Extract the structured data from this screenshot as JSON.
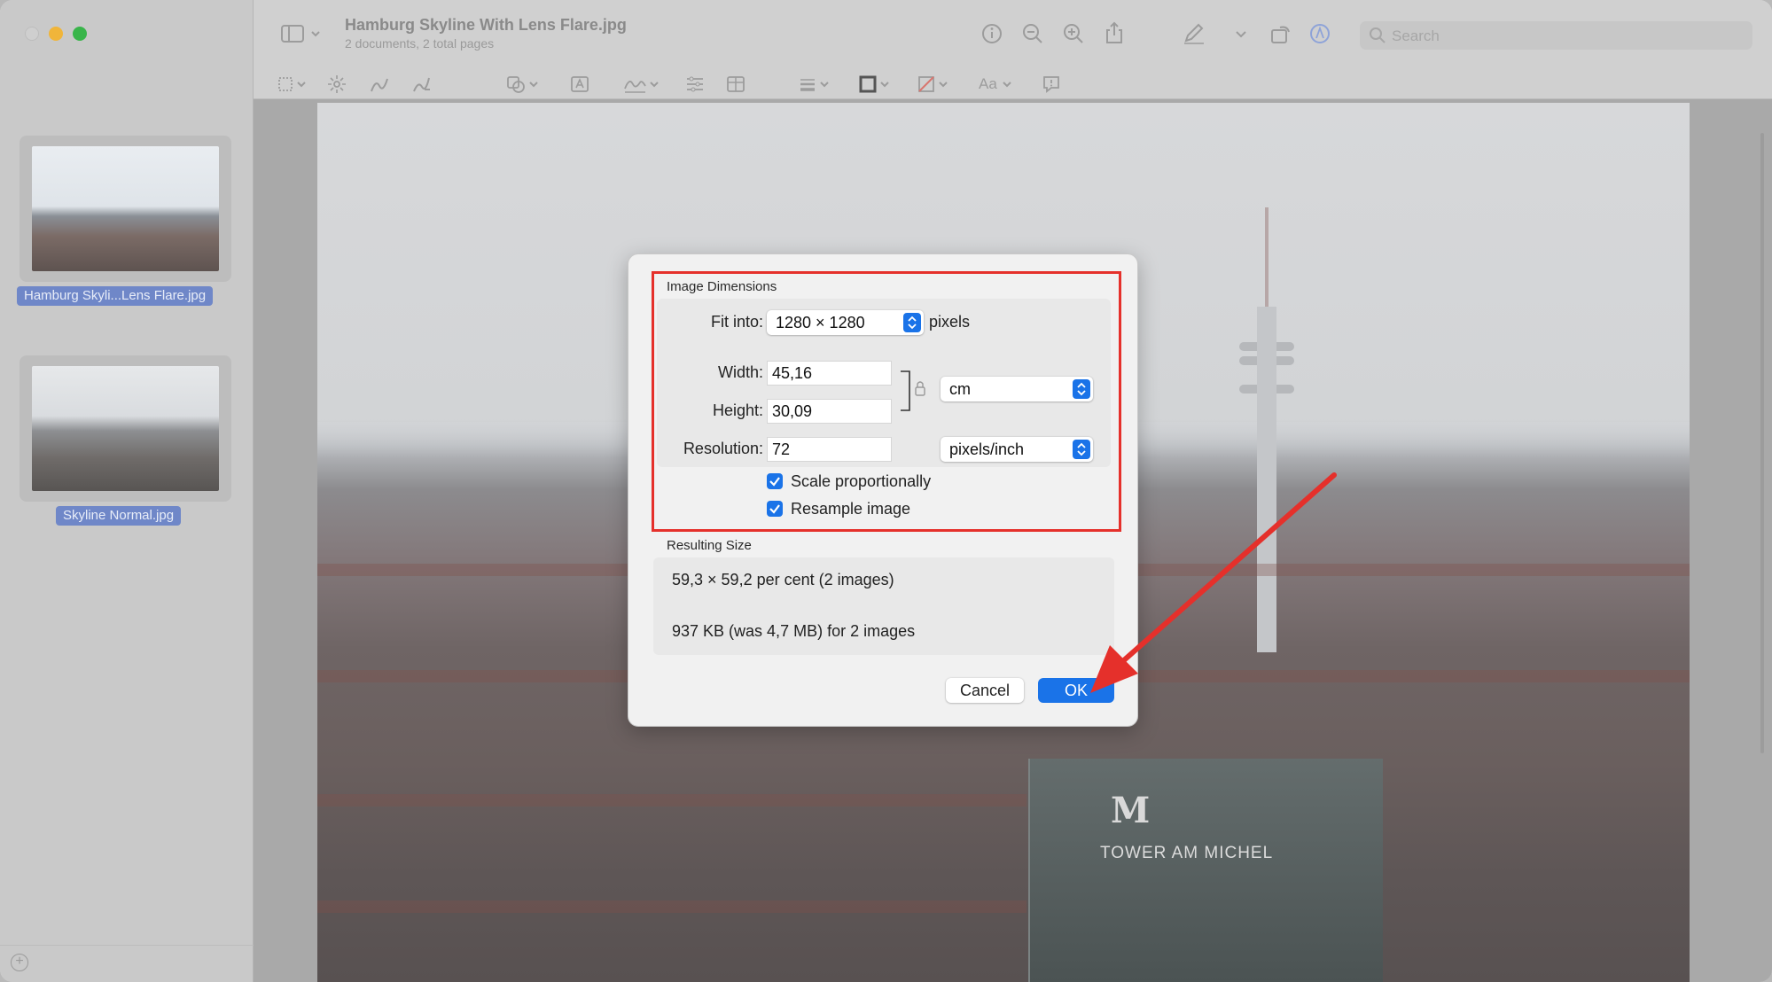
{
  "window": {
    "title": "Hamburg Skyline With Lens Flare.jpg",
    "subtitle": "2 documents, 2 total pages"
  },
  "sidebar": {
    "items": [
      {
        "label": "Hamburg Skyli...Lens Flare.jpg",
        "selected": true
      },
      {
        "label": "Skyline Normal.jpg",
        "selected": false
      }
    ]
  },
  "toolbar": {
    "search_placeholder": "Search",
    "text_style_label": "Aa",
    "icons": [
      "sidebar-icon",
      "info-icon",
      "zoom-out-icon",
      "zoom-in-icon",
      "share-icon",
      "markup-pen-icon",
      "rotate-icon",
      "markup-circle-icon",
      "search-icon",
      "rect-selection-icon",
      "instant-alpha-icon",
      "sketch-icon",
      "draw-icon",
      "shapes-icon",
      "text-box-icon",
      "sign-icon",
      "adjust-color-icon",
      "adjust-size-icon",
      "shape-style-icon",
      "border-color-icon",
      "fill-color-icon",
      "text-style-icon",
      "note-icon"
    ]
  },
  "image": {
    "building_text": "TOWER AM MICHEL",
    "logo": "M"
  },
  "dialog": {
    "dimensions_title": "Image Dimensions",
    "fit_into_label": "Fit into:",
    "fit_into_value": "1280 × 1280",
    "fit_into_unit": "pixels",
    "width_label": "Width:",
    "width_value": "45,16",
    "height_label": "Height:",
    "height_value": "30,09",
    "size_unit": "cm",
    "resolution_label": "Resolution:",
    "resolution_value": "72",
    "resolution_unit": "pixels/inch",
    "scale_label": "Scale proportionally",
    "scale_checked": true,
    "resample_label": "Resample image",
    "resample_checked": true,
    "resulting_title": "Resulting Size",
    "result_percent": "59,3 × 59,2 per cent (2 images)",
    "result_size": "937 KB (was 4,7 MB) for 2 images",
    "cancel_label": "Cancel",
    "ok_label": "OK"
  },
  "colors": {
    "accent": "#1a73e8",
    "annotation": "#e5302b"
  }
}
